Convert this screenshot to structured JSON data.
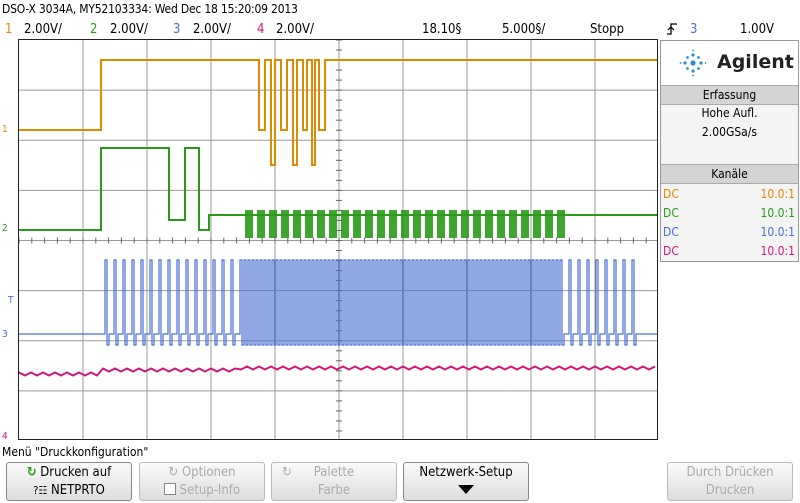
{
  "header": {
    "title": "DSO-X 3034A, MY52103334: Wed Dec 18 15:20:09 2013"
  },
  "channel_bar": {
    "channels": [
      {
        "num": "1",
        "scale": "2.00V/",
        "color": "#e08a00"
      },
      {
        "num": "2",
        "scale": "2.00V/",
        "color": "#2a9a1a"
      },
      {
        "num": "3",
        "scale": "2.00V/",
        "color": "#4a6fd4"
      },
      {
        "num": "4",
        "scale": "2.00V/",
        "color": "#d0187a"
      }
    ],
    "time_offset": "18.10§",
    "time_scale": "5.000§/",
    "run_state": "Stopp",
    "trigger_channel": "3",
    "trigger_level": "1.00V"
  },
  "grid_markers": [
    {
      "label": "1",
      "color": "#e08a00"
    },
    {
      "label": "2",
      "color": "#2a9a1a"
    },
    {
      "label": "T",
      "color": "#4a6fd4"
    },
    {
      "label": "3",
      "color": "#4a6fd4"
    },
    {
      "label": "4",
      "color": "#d0187a"
    }
  ],
  "brand": "Agilent",
  "acquisition": {
    "heading": "Erfassung",
    "mode": "Hohe Aufl.",
    "sample_rate": "2.00GSa/s"
  },
  "channels_panel": {
    "heading": "Kanäle",
    "rows": [
      {
        "coupling": "DC",
        "probe": "10.0:1",
        "color": "#e08a00"
      },
      {
        "coupling": "DC",
        "probe": "10.0:1",
        "color": "#2a9a1a"
      },
      {
        "coupling": "DC",
        "probe": "10.0:1",
        "color": "#4a6fd4"
      },
      {
        "coupling": "DC",
        "probe": "10.0:1",
        "color": "#d0187a"
      }
    ]
  },
  "menu_title": "Menü \"Druckkonfiguration\"",
  "softkeys": {
    "print_to": {
      "line1": "Drucken auf",
      "line2": "NETPRTO"
    },
    "options": {
      "line1": "Optionen",
      "line2": "Setup-Info"
    },
    "palette": {
      "line1": "Palette",
      "line2": "Farbe"
    },
    "network": {
      "line1": "Netzwerk-Setup"
    },
    "print": {
      "line1": "Durch Drücken",
      "line2": "Drucken"
    }
  }
}
